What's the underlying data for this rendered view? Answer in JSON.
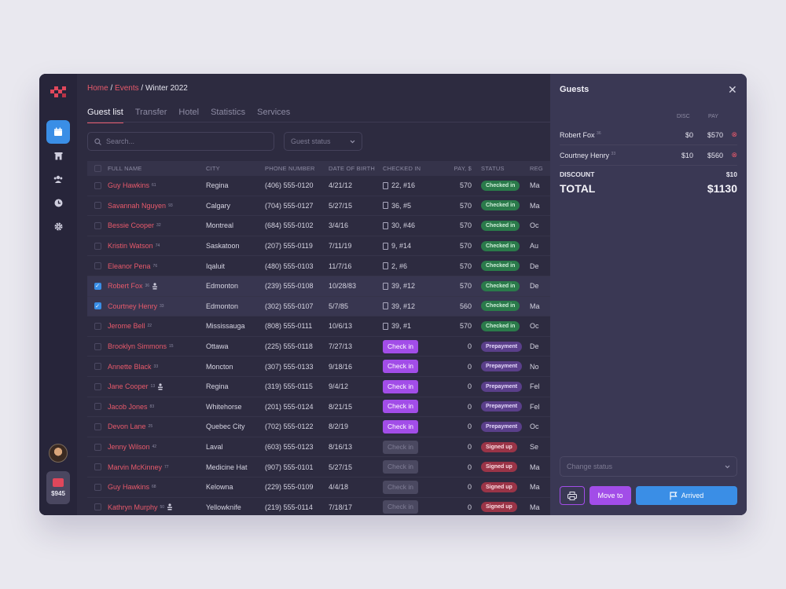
{
  "breadcrumb": {
    "home": "Home",
    "events": "Events",
    "current": "Winter 2022",
    "sep": " / "
  },
  "tabs": [
    "Guest list",
    "Transfer",
    "Hotel",
    "Statistics",
    "Services"
  ],
  "search": {
    "placeholder": "Search..."
  },
  "status_filter": {
    "label": "Guest status"
  },
  "table": {
    "headers": {
      "name": "FULL NAME",
      "city": "CITY",
      "phone": "PHONE NUMBER",
      "dob": "DATE OF BIRTH",
      "checked_in": "CHECKED IN",
      "pay": "PAY, $",
      "status": "STATUS",
      "rest": "REG"
    },
    "rows": [
      {
        "name": "Guy Hawkins",
        "age": "61",
        "vip": false,
        "city": "Regina",
        "phone": "(406) 555-0120",
        "dob": "4/21/12",
        "room": "22, #16",
        "button": "",
        "pay": "570",
        "status": "Checked in",
        "kind": "checked",
        "rest": "Ma",
        "selected": false
      },
      {
        "name": "Savannah Nguyen",
        "age": "93",
        "vip": false,
        "city": "Calgary",
        "phone": "(704) 555-0127",
        "dob": "5/27/15",
        "room": "36, #5",
        "button": "",
        "pay": "570",
        "status": "Checked in",
        "kind": "checked",
        "rest": "Ma",
        "selected": false
      },
      {
        "name": "Bessie Cooper",
        "age": "32",
        "vip": false,
        "city": "Montreal",
        "phone": "(684) 555-0102",
        "dob": "3/4/16",
        "room": "30, #46",
        "button": "",
        "pay": "570",
        "status": "Checked in",
        "kind": "checked",
        "rest": "Oc",
        "selected": false
      },
      {
        "name": "Kristin Watson",
        "age": "74",
        "vip": false,
        "city": "Saskatoon",
        "phone": "(207) 555-0119",
        "dob": "7/11/19",
        "room": "9, #14",
        "button": "",
        "pay": "570",
        "status": "Checked in",
        "kind": "checked",
        "rest": "Au",
        "selected": false
      },
      {
        "name": "Eleanor Pena",
        "age": "76",
        "vip": false,
        "city": "Iqaluit",
        "phone": "(480) 555-0103",
        "dob": "11/7/16",
        "room": "2, #6",
        "button": "",
        "pay": "570",
        "status": "Checked in",
        "kind": "checked",
        "rest": "De",
        "selected": false
      },
      {
        "name": "Robert Fox",
        "age": "36",
        "vip": true,
        "city": "Edmonton",
        "phone": "(239) 555-0108",
        "dob": "10/28/83",
        "room": "39, #12",
        "button": "",
        "pay": "570",
        "status": "Checked in",
        "kind": "checked",
        "rest": "De",
        "selected": true
      },
      {
        "name": "Courtney Henry",
        "age": "33",
        "vip": false,
        "city": "Edmonton",
        "phone": "(302) 555-0107",
        "dob": "5/7/85",
        "room": "39, #12",
        "button": "",
        "pay": "560",
        "status": "Checked in",
        "kind": "checked",
        "rest": "Ma",
        "selected": true
      },
      {
        "name": "Jerome Bell",
        "age": "22",
        "vip": false,
        "city": "Mississauga",
        "phone": "(808) 555-0111",
        "dob": "10/6/13",
        "room": "39, #1",
        "button": "",
        "pay": "570",
        "status": "Checked in",
        "kind": "checked",
        "rest": "Oc",
        "selected": false
      },
      {
        "name": "Brooklyn Simmons",
        "age": "15",
        "vip": false,
        "city": "Ottawa",
        "phone": "(225) 555-0118",
        "dob": "7/27/13",
        "room": "",
        "button": "Check in",
        "pay": "0",
        "status": "Prepayment",
        "kind": "prepay",
        "rest": "De",
        "selected": false
      },
      {
        "name": "Annette Black",
        "age": "33",
        "vip": false,
        "city": "Moncton",
        "phone": "(307) 555-0133",
        "dob": "9/18/16",
        "room": "",
        "button": "Check in",
        "pay": "0",
        "status": "Prepayment",
        "kind": "prepay",
        "rest": "No",
        "selected": false
      },
      {
        "name": "Jane Cooper",
        "age": "13",
        "vip": true,
        "city": "Regina",
        "phone": "(319) 555-0115",
        "dob": "9/4/12",
        "room": "",
        "button": "Check in",
        "pay": "0",
        "status": "Prepayment",
        "kind": "prepay",
        "rest": "Fel",
        "selected": false
      },
      {
        "name": "Jacob Jones",
        "age": "83",
        "vip": false,
        "city": "Whitehorse",
        "phone": "(201) 555-0124",
        "dob": "8/21/15",
        "room": "",
        "button": "Check in",
        "pay": "0",
        "status": "Prepayment",
        "kind": "prepay",
        "rest": "Fel",
        "selected": false
      },
      {
        "name": "Devon Lane",
        "age": "25",
        "vip": false,
        "city": "Quebec City",
        "phone": "(702) 555-0122",
        "dob": "8/2/19",
        "room": "",
        "button": "Check in",
        "pay": "0",
        "status": "Prepayment",
        "kind": "prepay",
        "rest": "Oc",
        "selected": false
      },
      {
        "name": "Jenny Wilson",
        "age": "42",
        "vip": false,
        "city": "Laval",
        "phone": "(603) 555-0123",
        "dob": "8/16/13",
        "room": "",
        "button": "Check in",
        "pay": "0",
        "status": "Signed up",
        "kind": "signed",
        "rest": "Se",
        "selected": false
      },
      {
        "name": "Marvin McKinney",
        "age": "77",
        "vip": false,
        "city": "Medicine Hat",
        "phone": "(907) 555-0101",
        "dob": "5/27/15",
        "room": "",
        "button": "Check in",
        "pay": "0",
        "status": "Signed up",
        "kind": "signed",
        "rest": "Ma",
        "selected": false
      },
      {
        "name": "Guy Hawkins",
        "age": "68",
        "vip": false,
        "city": "Kelowna",
        "phone": "(229) 555-0109",
        "dob": "4/4/18",
        "room": "",
        "button": "Check in",
        "pay": "0",
        "status": "Signed up",
        "kind": "signed",
        "rest": "Ma",
        "selected": false
      },
      {
        "name": "Kathryn Murphy",
        "age": "50",
        "vip": true,
        "city": "Yellowknife",
        "phone": "(219) 555-0114",
        "dob": "7/18/17",
        "room": "",
        "button": "Check in",
        "pay": "0",
        "status": "Signed up",
        "kind": "signed",
        "rest": "Ma",
        "selected": false
      }
    ]
  },
  "sidebar": {
    "wallet_amount": "$945"
  },
  "panel": {
    "title": "Guests",
    "col_disc": "DISC",
    "col_pay": "PAY",
    "guests": [
      {
        "name": "Robert Fox",
        "age": "36",
        "disc": "$0",
        "pay": "$570"
      },
      {
        "name": "Courtney Henry",
        "age": "33",
        "disc": "$10",
        "pay": "$560"
      }
    ],
    "discount_label": "DISCOUNT",
    "discount_value": "$10",
    "total_label": "TOTAL",
    "total_value": "$1130",
    "change_status": "Change status",
    "move_to": "Move to",
    "arrived": "Arrived"
  },
  "colors": {
    "accent": "#e85a6b",
    "primary": "#3a8ee6",
    "purple": "#a24de8",
    "checked": "#2a7a4a",
    "prepay": "#5a3f8a",
    "signed": "#9a3447"
  },
  "icons": [
    "logo",
    "calendar-icon",
    "hotel-icon",
    "users-icon",
    "clock-icon",
    "gear-icon",
    "search-icon",
    "chevron-down-icon",
    "close-icon",
    "printer-icon",
    "flag-icon",
    "document-icon",
    "crown-icon",
    "remove-icon"
  ]
}
